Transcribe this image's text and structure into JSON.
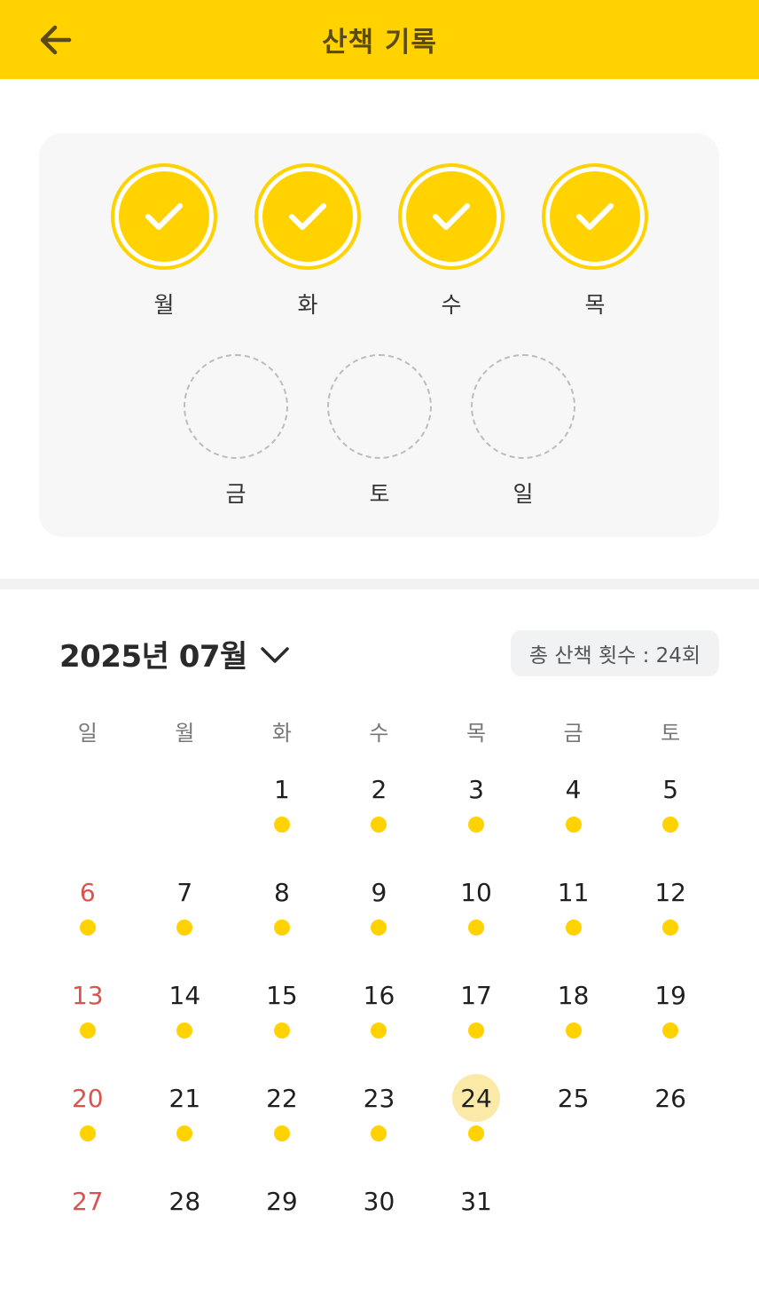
{
  "header": {
    "title": "산책 기록",
    "back_icon": "arrow-left-icon"
  },
  "colors": {
    "accent": "#FFD200",
    "sunday": "#D9534F",
    "today_highlight": "#FBE9A8"
  },
  "weekly_progress": [
    {
      "label": "월",
      "done": true
    },
    {
      "label": "화",
      "done": true
    },
    {
      "label": "수",
      "done": true
    },
    {
      "label": "목",
      "done": true
    },
    {
      "label": "금",
      "done": false
    },
    {
      "label": "토",
      "done": false
    },
    {
      "label": "일",
      "done": false
    }
  ],
  "calendar": {
    "month_label": "2025년 07월",
    "dropdown_icon": "chevron-down-icon",
    "total_label": "총 산책 횟수 : 24회",
    "weekdays": [
      "일",
      "월",
      "화",
      "수",
      "목",
      "금",
      "토"
    ],
    "today": 24,
    "weeks": [
      [
        null,
        null,
        {
          "d": "1",
          "walk": true
        },
        {
          "d": "2",
          "walk": true
        },
        {
          "d": "3",
          "walk": true
        },
        {
          "d": "4",
          "walk": true
        },
        {
          "d": "5",
          "walk": true
        }
      ],
      [
        {
          "d": "6",
          "walk": true
        },
        {
          "d": "7",
          "walk": true
        },
        {
          "d": "8",
          "walk": true
        },
        {
          "d": "9",
          "walk": true
        },
        {
          "d": "10",
          "walk": true
        },
        {
          "d": "11",
          "walk": true
        },
        {
          "d": "12",
          "walk": true
        }
      ],
      [
        {
          "d": "13",
          "walk": true
        },
        {
          "d": "14",
          "walk": true
        },
        {
          "d": "15",
          "walk": true
        },
        {
          "d": "16",
          "walk": true
        },
        {
          "d": "17",
          "walk": true
        },
        {
          "d": "18",
          "walk": true
        },
        {
          "d": "19",
          "walk": true
        }
      ],
      [
        {
          "d": "20",
          "walk": true
        },
        {
          "d": "21",
          "walk": true
        },
        {
          "d": "22",
          "walk": true
        },
        {
          "d": "23",
          "walk": true
        },
        {
          "d": "24",
          "walk": true
        },
        {
          "d": "25",
          "walk": false
        },
        {
          "d": "26",
          "walk": false
        }
      ],
      [
        {
          "d": "27",
          "walk": false
        },
        {
          "d": "28",
          "walk": false
        },
        {
          "d": "29",
          "walk": false
        },
        {
          "d": "30",
          "walk": false
        },
        {
          "d": "31",
          "walk": false
        },
        null,
        null
      ]
    ]
  }
}
